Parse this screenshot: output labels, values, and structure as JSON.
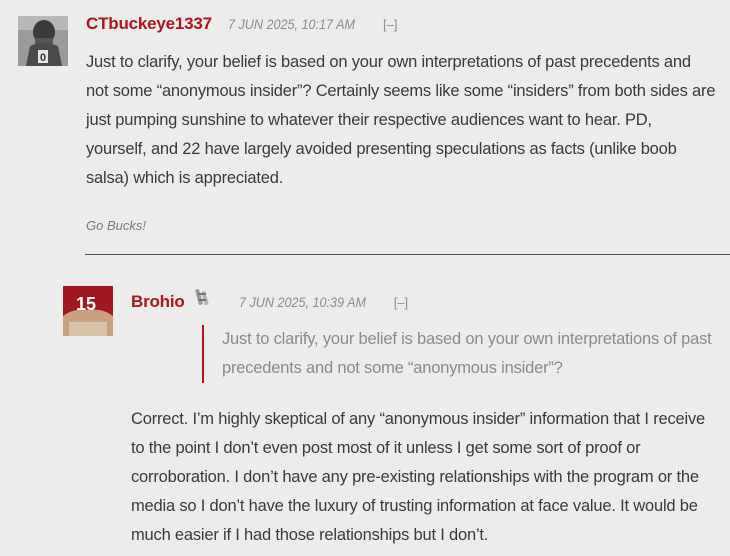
{
  "comments": [
    {
      "username": "CTbuckeye1337",
      "timestamp": "7 JUN 2025, 10:17 AM",
      "collapse": "[–]",
      "body": "Just to clarify, your belief is based on your own interpretations of past precedents and not some “anonymous insider”? Certainly seems like some “insiders” from both sides are just pumping sunshine to whatever their respective audiences want to hear. PD, yourself, and 22 have largely avoided presenting speculations as facts (unlike boob salsa) which is appreciated.",
      "signature": "Go Bucks!",
      "avatar_number": "0"
    },
    {
      "username": "Brohio",
      "timestamp": "7 JUN 2025, 10:39 AM",
      "collapse": "[–]",
      "quote": "Just to clarify, your belief is based on your own interpretations of past precedents and not some “anonymous insider”?",
      "body": "Correct. I’m highly skeptical of any “anonymous insider” information that I receive to the point I don’t even post most of it unless I get some sort of proof or corroboration. I don’t have any pre-existing relationships with the program or the media so I don’t have the luxury of trusting information at face value. It would be much easier if I had those relationships but I don’t.",
      "avatar_number": "15"
    }
  ],
  "colors": {
    "accent": "#b0141e",
    "background": "#ececec",
    "text": "#3a3a3a",
    "muted": "#8c8c8c"
  }
}
